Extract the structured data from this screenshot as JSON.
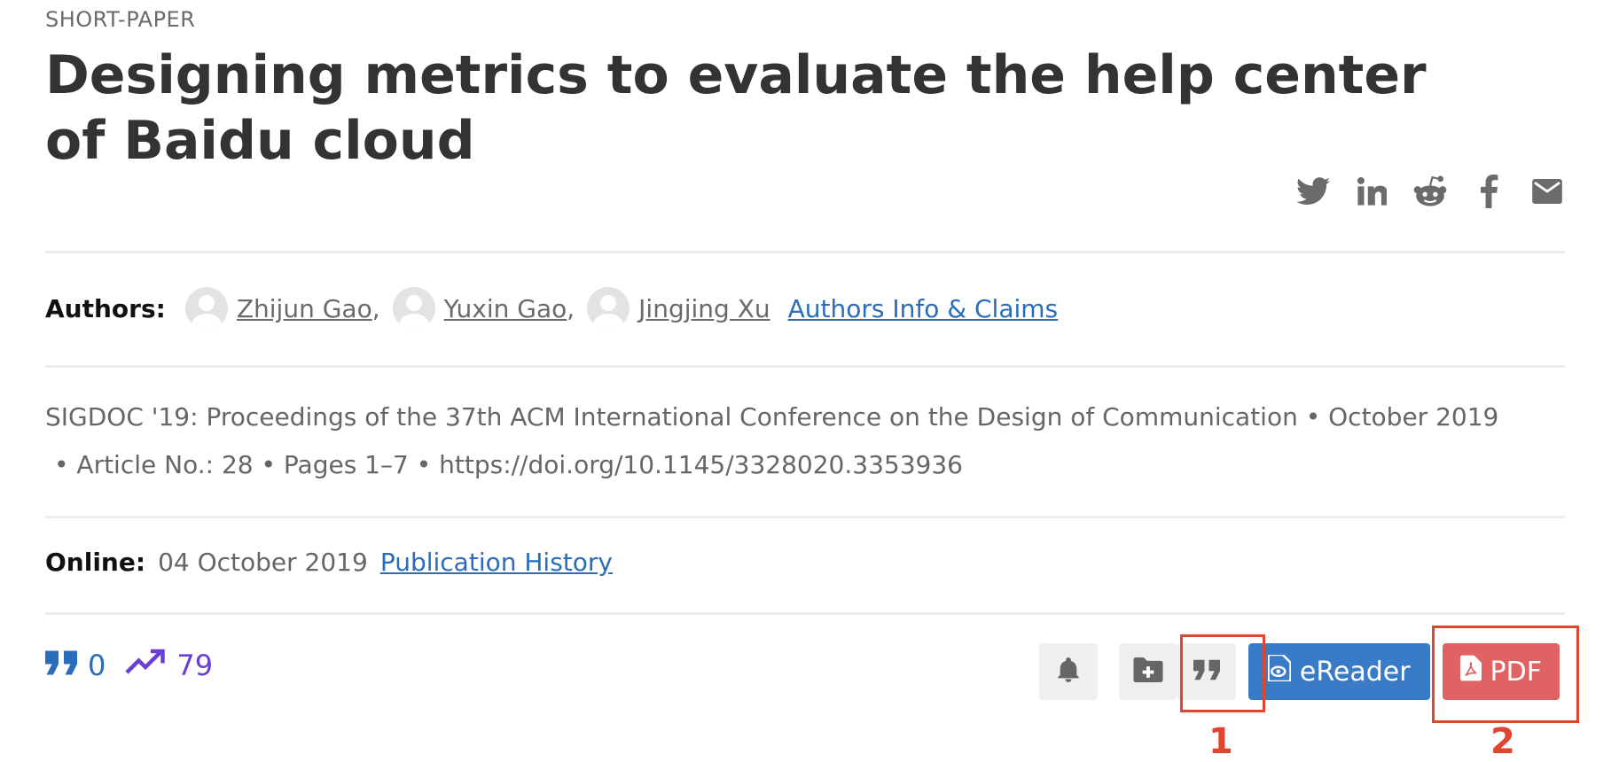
{
  "article": {
    "type_label": "SHORT-PAPER",
    "title": "Designing metrics to evaluate the help center of Baidu cloud"
  },
  "share_icons": [
    "twitter-icon",
    "linkedin-icon",
    "reddit-icon",
    "facebook-icon",
    "email-icon"
  ],
  "authors": {
    "label": "Authors:",
    "list": [
      {
        "name": "Zhijun Gao",
        "sep": ","
      },
      {
        "name": "Yuxin Gao",
        "sep": ","
      },
      {
        "name": "Jingjing Xu",
        "sep": ""
      }
    ],
    "info_link": "Authors Info & Claims"
  },
  "citation": {
    "line1": "SIGDOC '19: Proceedings of the 37th ACM International Conference on the Design of Communication • October 2019",
    "line2": "• Article No.: 28 • Pages 1–7 • https://doi.org/10.1145/3328020.3353936"
  },
  "online": {
    "label": "Online:",
    "date": "04 October 2019",
    "history_link": "Publication History"
  },
  "metrics": {
    "citations": "0",
    "downloads": "79"
  },
  "actions": {
    "ereader_label": "eReader",
    "pdf_label": "PDF"
  },
  "annotations": {
    "marker1": "1",
    "marker2": "2"
  },
  "colors": {
    "link": "#2a6ebb",
    "ereader": "#3a7bc8",
    "pdf": "#e06262",
    "highlight": "#e0452f"
  }
}
